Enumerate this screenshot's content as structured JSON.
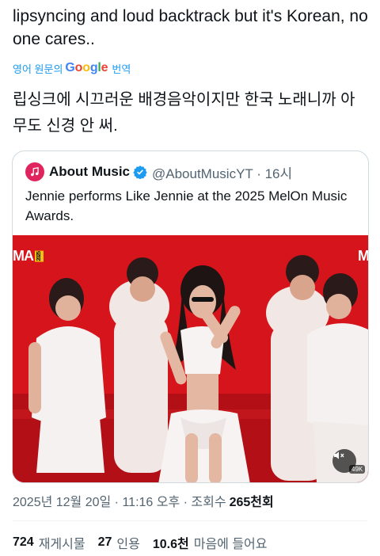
{
  "tweet": {
    "text": "lipsyncing and loud backtrack but it's Korean, no one cares..",
    "translate": {
      "prefix": "영어 원문의",
      "google": [
        "G",
        "o",
        "o",
        "g",
        "l",
        "e"
      ],
      "suffix": "번역"
    },
    "translated_text": "립싱크에 시끄러운 배경음악이지만 한국 노래니까 아무도 신경 안 써."
  },
  "quote": {
    "author_name": "About Music",
    "handle_time": "@AboutMusicYT · 16시",
    "text": "Jennie performs Like Jennie at the 2025 MelOn Music Awards.",
    "media": {
      "logo_left": "MA",
      "logo_badge": "2025",
      "logo_right": "M",
      "views": "49K"
    }
  },
  "meta": {
    "timestamp": "2025년 12월 20일 · 11:16 오후 · 조회수",
    "views": "265천회"
  },
  "stats": [
    {
      "count": "724",
      "label": "재게시물"
    },
    {
      "count": "27",
      "label": "인용"
    },
    {
      "count": "10.6천",
      "label": "마음에 들어요"
    }
  ],
  "colors": {
    "accent": "#1d9bf0",
    "verified": "#1d9bf0",
    "media_red": "#d5141b"
  },
  "icons": {
    "avatar": "music-note-icon",
    "verified": "verified-badge-icon",
    "mute": "speaker-muted-icon"
  }
}
